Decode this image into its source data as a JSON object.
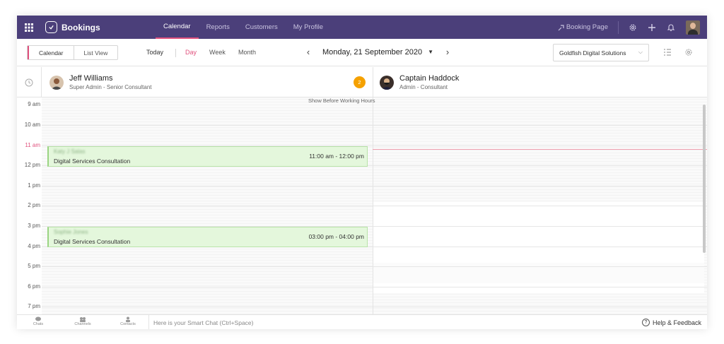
{
  "app": {
    "name": "Bookings"
  },
  "nav": [
    {
      "label": "Calendar",
      "active": true
    },
    {
      "label": "Reports",
      "active": false
    },
    {
      "label": "Customers",
      "active": false
    },
    {
      "label": "My Profile",
      "active": false
    }
  ],
  "topbar": {
    "booking_page": "Booking Page"
  },
  "toolbar": {
    "view_toggle": [
      {
        "label": "Calendar",
        "active": true
      },
      {
        "label": "List View",
        "active": false
      }
    ],
    "today": "Today",
    "views": [
      {
        "label": "Day",
        "active": true
      },
      {
        "label": "Week",
        "active": false
      },
      {
        "label": "Month",
        "active": false
      }
    ],
    "date": "Monday, 21 September 2020",
    "org": "Goldfish Digital Solutions"
  },
  "staff": [
    {
      "name": "Jeff Williams",
      "role": "Super Admin - Senior Consultant",
      "badge": "2"
    },
    {
      "name": "Captain Haddock",
      "role": "Admin - Consultant"
    }
  ],
  "grid": {
    "show_before": "Show Before Working Hours",
    "hours": [
      "9 am",
      "10 am",
      "11 am",
      "12 pm",
      "1 pm",
      "2 pm",
      "3 pm",
      "4 pm",
      "5 pm",
      "6 pm",
      "7 pm"
    ],
    "current_hour": "11 am"
  },
  "appointments": [
    {
      "customer": "Katy J Salas",
      "service": "Digital Services Consultation",
      "time": "11:00 am - 12:00 pm"
    },
    {
      "customer": "Sophie Jones",
      "service": "Digital Services Consultation",
      "time": "03:00 pm - 04:00 pm"
    }
  ],
  "bottom": {
    "items": [
      "Chats",
      "Channels",
      "Contacts"
    ],
    "chat_placeholder": "Here is your Smart Chat (Ctrl+Space)",
    "help": "Help & Feedback"
  },
  "colors": {
    "topbar": "#4b3f7a",
    "accent": "#e0517d",
    "appointment": "#e4f7dc",
    "badge": "#f5a100"
  }
}
